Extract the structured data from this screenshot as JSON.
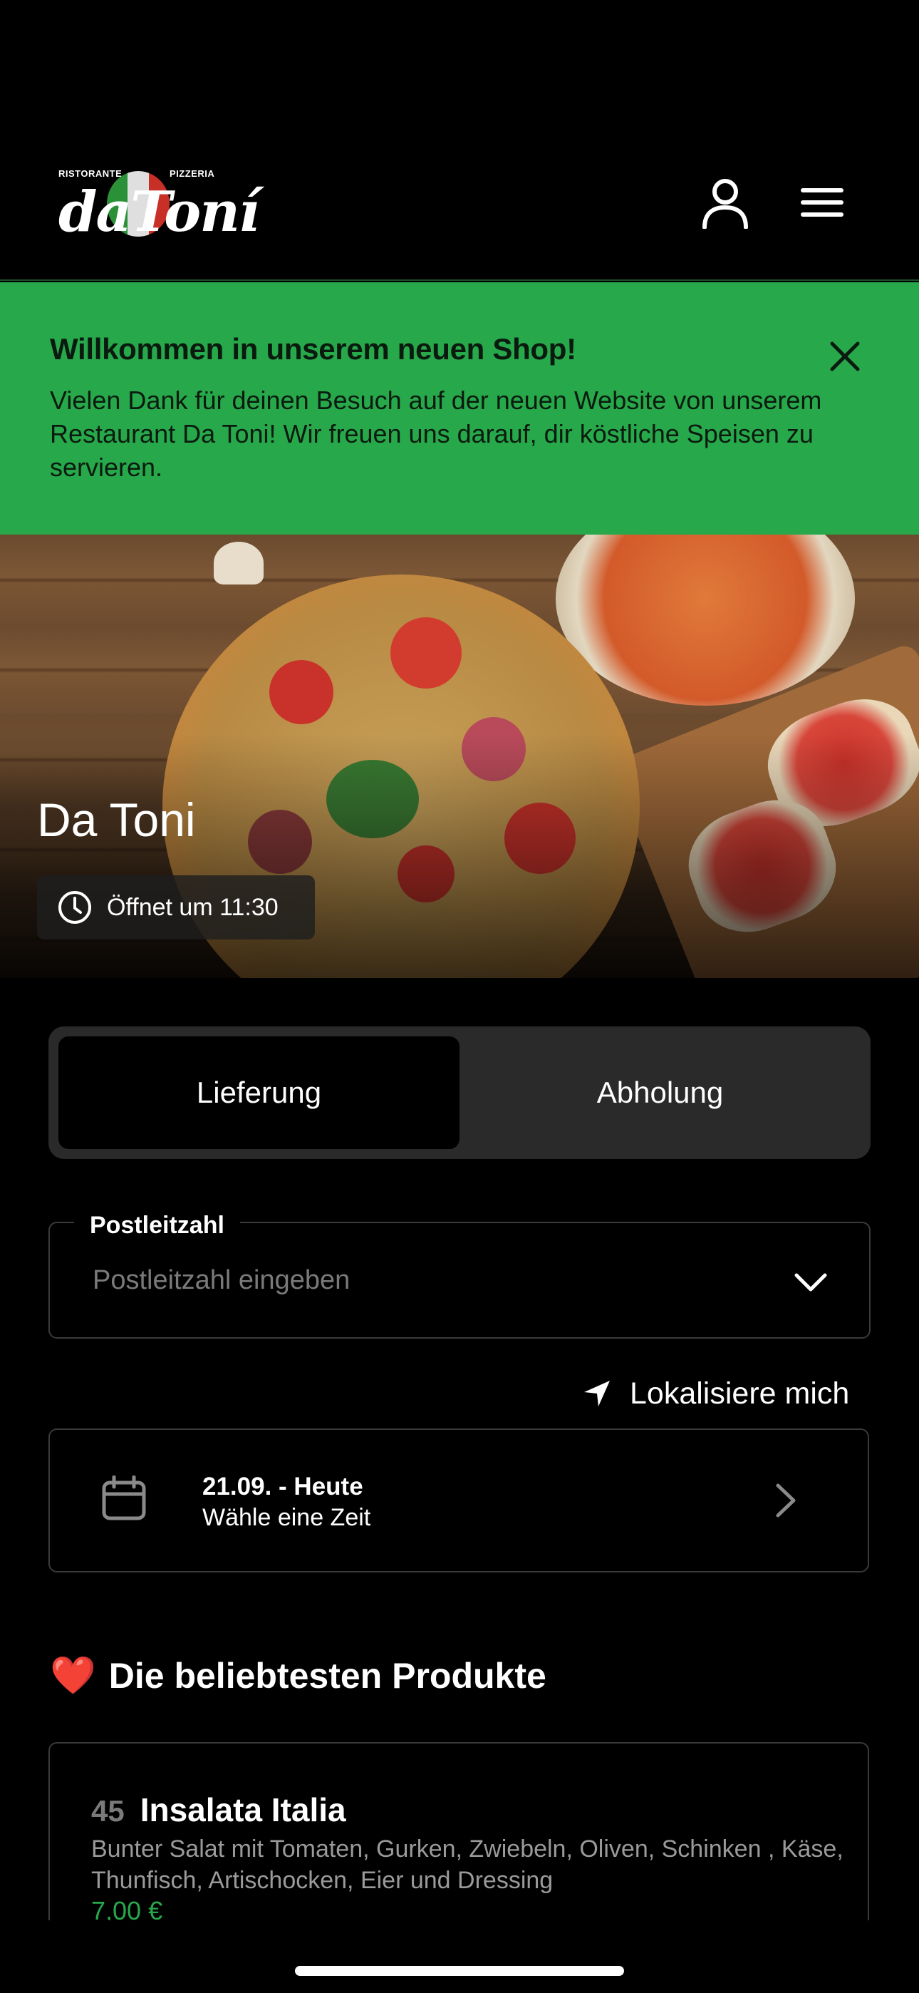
{
  "header": {
    "logo": {
      "small_left": "RISTORANTE",
      "small_right": "PIZZERIA",
      "word": "daToní"
    },
    "icons": {
      "account": "user-icon",
      "menu": "hamburger-menu-icon"
    }
  },
  "banner": {
    "title": "Willkommen in unserem neuen Shop!",
    "text": "Vielen Dank für deinen Besuch auf der neuen Website von unserem Restaurant Da Toni! Wir freuen uns darauf, dir köstliche Speisen zu servieren.",
    "close_icon": "close-icon",
    "color": "#27a84a"
  },
  "hero": {
    "title": "Da Toni",
    "hours": "Öffnet um 11:30",
    "hours_icon": "clock-icon"
  },
  "order_mode": {
    "options": [
      "Lieferung",
      "Abholung"
    ],
    "selected": "Lieferung"
  },
  "postal": {
    "label": "Postleitzahl",
    "placeholder": "Postleitzahl eingeben",
    "value": ""
  },
  "locate": {
    "label": "Lokalisiere mich",
    "icon": "location-arrow-icon"
  },
  "date_picker": {
    "date": "21.09. - Heute",
    "time": "Wähle eine Zeit",
    "icon": "calendar-icon"
  },
  "popular": {
    "heading_emoji": "❤️",
    "heading": "Die beliebtesten Produkte",
    "products": [
      {
        "number": "45",
        "name": "Insalata Italia",
        "description": "Bunter Salat mit Tomaten, Gurken, Zwiebeln, Oliven, Schinken , Käse, Thunfisch, Artischocken, Eier und Dressing",
        "price": "7,00 €"
      }
    ]
  },
  "colors": {
    "accent": "#27a84a",
    "background": "#000000",
    "surface": "#2a2a2a"
  }
}
